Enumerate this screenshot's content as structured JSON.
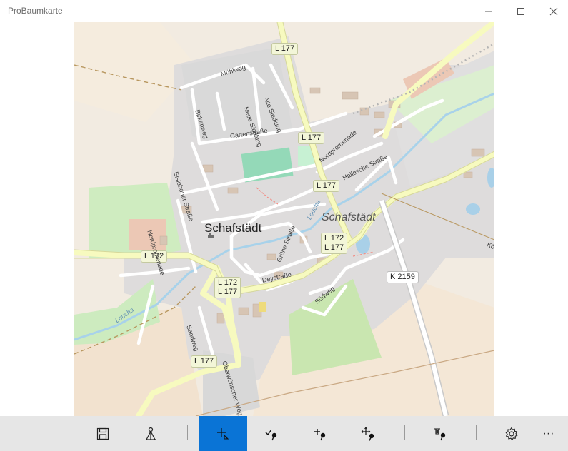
{
  "window": {
    "title": "ProBaumkarte"
  },
  "map": {
    "place_name": "Schafstädt",
    "place_name_italic": "Schafstädt",
    "river_name": "Loucha",
    "shields": {
      "l177_top": "L 177",
      "l177_mid": "L 177",
      "l177_center": "L 177",
      "l172_l177_a_top": "L 172",
      "l172_l177_a_bottom": "L 177",
      "l172_left": "L 172",
      "l172_l177_b_top": "L 172",
      "l172_l177_b_bottom": "L 177",
      "k2159": "K 2159",
      "l177_bottom": "L 177"
    },
    "streets": {
      "muehlweg": "Mühlweg",
      "neue_siedlung": "Neue Siedlung",
      "alte_siedlung": "Alte Siedlung",
      "birkenweg": "Birkenweg",
      "gartenstrasse": "Gartenstraße",
      "eislebener_strasse": "Eislebener Straße",
      "nordpromenade_east": "Nordpromenade",
      "hallesche_strasse": "Hallesche Straße",
      "nordpromenade_west": "Nordpromenade",
      "grune_strasse": "Grüne Straße",
      "deystrasse": "Deystraße",
      "suedweg": "Südweg",
      "sandweg": "Sandweg",
      "oberwuenscher_weg": "Oberwünscher Weg",
      "edge_ko": "Kö"
    }
  },
  "toolbar": {
    "buttons": [
      {
        "name": "save",
        "icon": "save-icon"
      },
      {
        "name": "survey",
        "icon": "surveyor-icon"
      },
      {
        "name": "pan-mode",
        "icon": "pan-crosshair-icon",
        "active": true
      },
      {
        "name": "check-tree",
        "icon": "check-pin-icon"
      },
      {
        "name": "add-tree",
        "icon": "add-pin-icon"
      },
      {
        "name": "move-tree",
        "icon": "move-pin-icon"
      },
      {
        "name": "delete-tree",
        "icon": "delete-pin-icon"
      },
      {
        "name": "settings",
        "icon": "gear-icon"
      },
      {
        "name": "more",
        "icon": "more-icon"
      }
    ],
    "more_label": "···",
    "accent": "#0a74d6"
  }
}
